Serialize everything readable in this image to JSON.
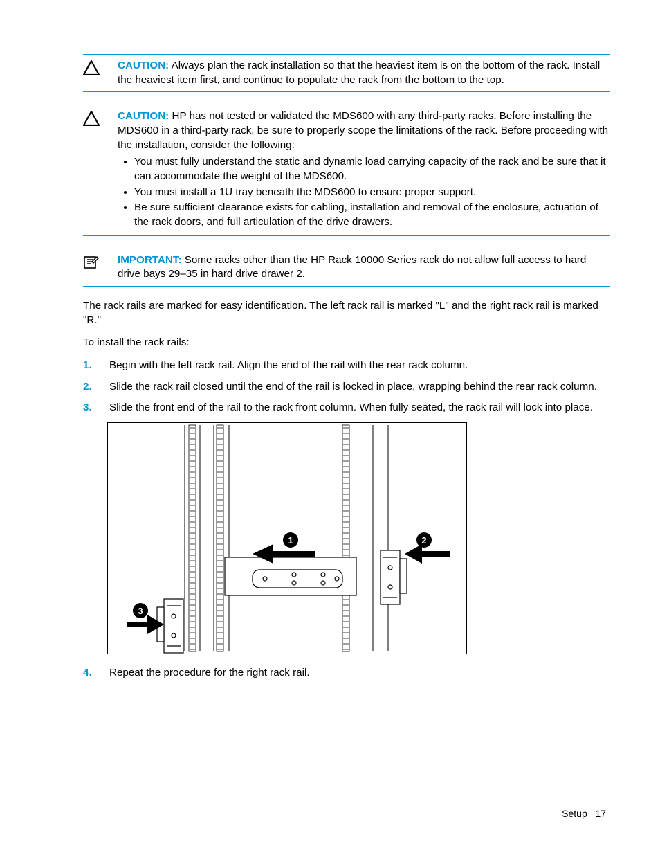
{
  "admonitions": [
    {
      "icon": "caution-triangle-icon",
      "label": "CAUTION:",
      "text": "Always plan the rack installation so that the heaviest item is on the bottom of the rack. Install the heaviest item first, and continue to populate the rack from the bottom to the top."
    },
    {
      "icon": "caution-triangle-icon",
      "label": "CAUTION:",
      "text": "HP has not tested or validated the MDS600 with any third-party racks. Before installing the MDS600 in a third-party rack, be sure to properly scope the limitations of the rack. Before proceeding with the installation, consider the following:",
      "bullets": [
        "You must fully understand the static and dynamic load carrying capacity of the rack and be sure that it can accommodate the weight of the MDS600.",
        "You must install a 1U tray beneath the MDS600 to ensure proper support.",
        "Be sure sufficient clearance exists for cabling, installation and removal of the enclosure, actuation of the rack doors, and full articulation of the drive drawers."
      ]
    },
    {
      "icon": "important-note-icon",
      "label": "IMPORTANT:",
      "text": "Some racks other than the HP Rack 10000 Series rack do not allow full access to hard drive bays 29–35 in hard drive drawer 2."
    }
  ],
  "intro1": "The rack rails are marked for easy identification. The left rack rail is marked \"L\" and the right rack rail is marked \"R.\"",
  "intro2": "To install the rack rails:",
  "steps": [
    "Begin with the left rack rail. Align the end of the rail with the rear rack column.",
    "Slide the rack rail closed until the end of the rail is locked in place, wrapping behind the rear rack column.",
    "Slide the front end of the rail to the rack front column. When fully seated, the rack rail will lock into place."
  ],
  "step4": "Repeat the procedure for the right rack rail.",
  "footer": {
    "section": "Setup",
    "page": "17"
  }
}
